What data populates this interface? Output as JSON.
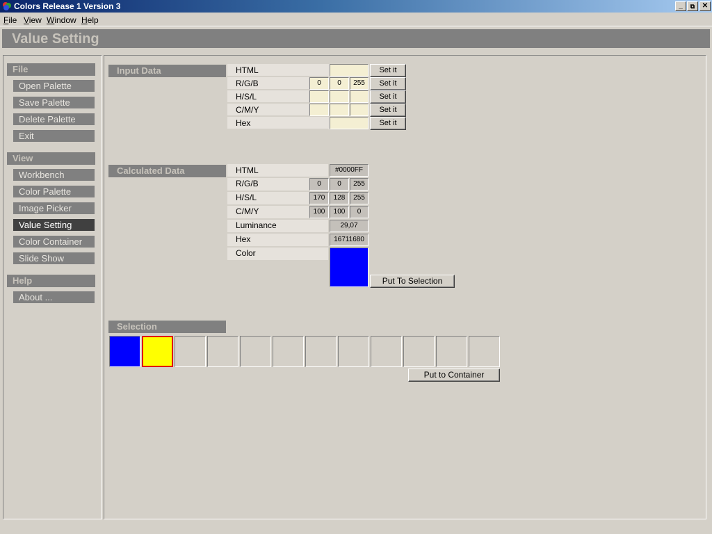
{
  "window": {
    "title": "Colors Release 1 Version 3",
    "controls": [
      "minimize",
      "restore",
      "close"
    ]
  },
  "menu": [
    "File",
    "View",
    "Window",
    "Help"
  ],
  "page_title": "Value Setting",
  "sidebar": {
    "sections": [
      {
        "title": "File",
        "items": [
          "Open Palette",
          "Save Palette",
          "Delete Palette",
          "Exit"
        ]
      },
      {
        "title": "View",
        "items": [
          "Workbench",
          "Color Palette",
          "Image Picker",
          "Value Setting",
          "Color Container",
          "Slide Show"
        ]
      },
      {
        "title": "Help",
        "items": [
          "About ..."
        ]
      }
    ],
    "active_item": "Value Setting"
  },
  "input_data": {
    "title": "Input Data",
    "rows": {
      "html": {
        "label": "HTML",
        "value": ""
      },
      "rgb": {
        "label": "R/G/B",
        "values": [
          "0",
          "0",
          "255"
        ]
      },
      "hsl": {
        "label": "H/S/L",
        "values": [
          "",
          "",
          ""
        ]
      },
      "cmy": {
        "label": "C/M/Y",
        "values": [
          "",
          "",
          ""
        ]
      },
      "hex": {
        "label": "Hex",
        "value": ""
      }
    },
    "set_label": "Set it"
  },
  "calculated_data": {
    "title": "Calculated Data",
    "rows": {
      "html": {
        "label": "HTML",
        "value": "#0000FF"
      },
      "rgb": {
        "label": "R/G/B",
        "values": [
          "0",
          "0",
          "255"
        ]
      },
      "hsl": {
        "label": "H/S/L",
        "values": [
          "170",
          "128",
          "255"
        ]
      },
      "cmy": {
        "label": "C/M/Y",
        "values": [
          "100",
          "100",
          "0"
        ]
      },
      "luminance": {
        "label": "Luminance",
        "value": "29,07"
      },
      "hex": {
        "label": "Hex",
        "value": "16711680"
      },
      "color": {
        "label": "Color",
        "swatch": "#0000FF"
      }
    },
    "put_to_selection_label": "Put To Selection"
  },
  "selection": {
    "title": "Selection",
    "swatches": [
      "#0000FF",
      "#FFFF00",
      "",
      "",
      "",
      "",
      "",
      "",
      "",
      "",
      "",
      ""
    ],
    "selected_index": 1,
    "put_to_container_label": "Put to Container"
  }
}
